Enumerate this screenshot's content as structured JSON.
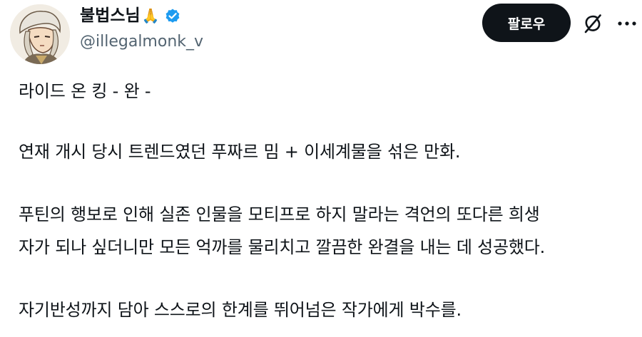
{
  "author": {
    "display_name": "불법스님",
    "emoji": "🙏",
    "handle": "@illegalmonk_v",
    "verified": true
  },
  "actions": {
    "follow_label": "팔로우",
    "grok_icon": "grok-icon",
    "more_icon": "more-icon"
  },
  "post": {
    "lines": [
      "라이드 온 킹 - 완 -",
      "연재 개시 당시 트렌드였던 푸짜르 밈 + 이세계물을 섞은 만화.",
      "푸틴의 행보로 인해 실존 인물을 모티프로 하지 말라는 격언의 또다른 희생",
      "자가 되나 싶더니만 모든 억까를 물리치고 깔끔한 완결을 내는 데 성공했다.",
      "자기반성까지 담아 스스로의 한계를 뛰어넘은 작가에게 박수를."
    ]
  },
  "colors": {
    "text_primary": "#0f1419",
    "text_secondary": "#536471",
    "verified_blue": "#1d9bf0",
    "follow_bg": "#0f1419"
  }
}
